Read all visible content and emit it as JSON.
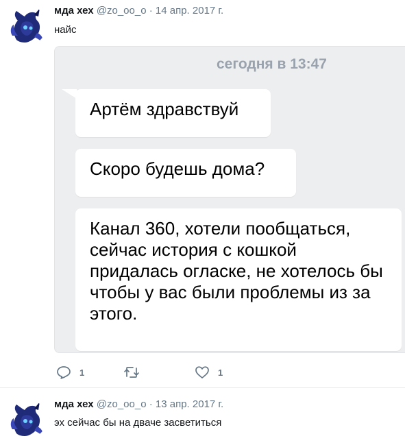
{
  "tweets": [
    {
      "name": "мда хех",
      "handle": "@zo_oo_o",
      "separator": "·",
      "date": "14 апр. 2017 г.",
      "text": "найс",
      "media": {
        "timestamp": "сегодня в 13:47",
        "messages": [
          "Артём здравствуй",
          "Скоро будешь дома?",
          "Канал 360, хотели пообщаться, сейчас история с кошкой придалась огласке, не хотелось бы чтобы у вас были проблемы из за этого."
        ]
      },
      "actions": {
        "reply_count": "1",
        "retweet_count": "",
        "like_count": "1"
      }
    },
    {
      "name": "мда хех",
      "handle": "@zo_oo_o",
      "separator": "·",
      "date": "13 апр. 2017 г.",
      "text": "эх сейчас бы на дваче засветиться"
    }
  ],
  "icons": {
    "reply": "reply-icon",
    "retweet": "retweet-icon",
    "like": "heart-icon",
    "avatar": "avatar-pony-image"
  },
  "colors": {
    "secondary_text": "#657786",
    "media_background": "#edeef0",
    "timestamp": "#99a2ad",
    "avatar_mane": "#1f2a78"
  }
}
